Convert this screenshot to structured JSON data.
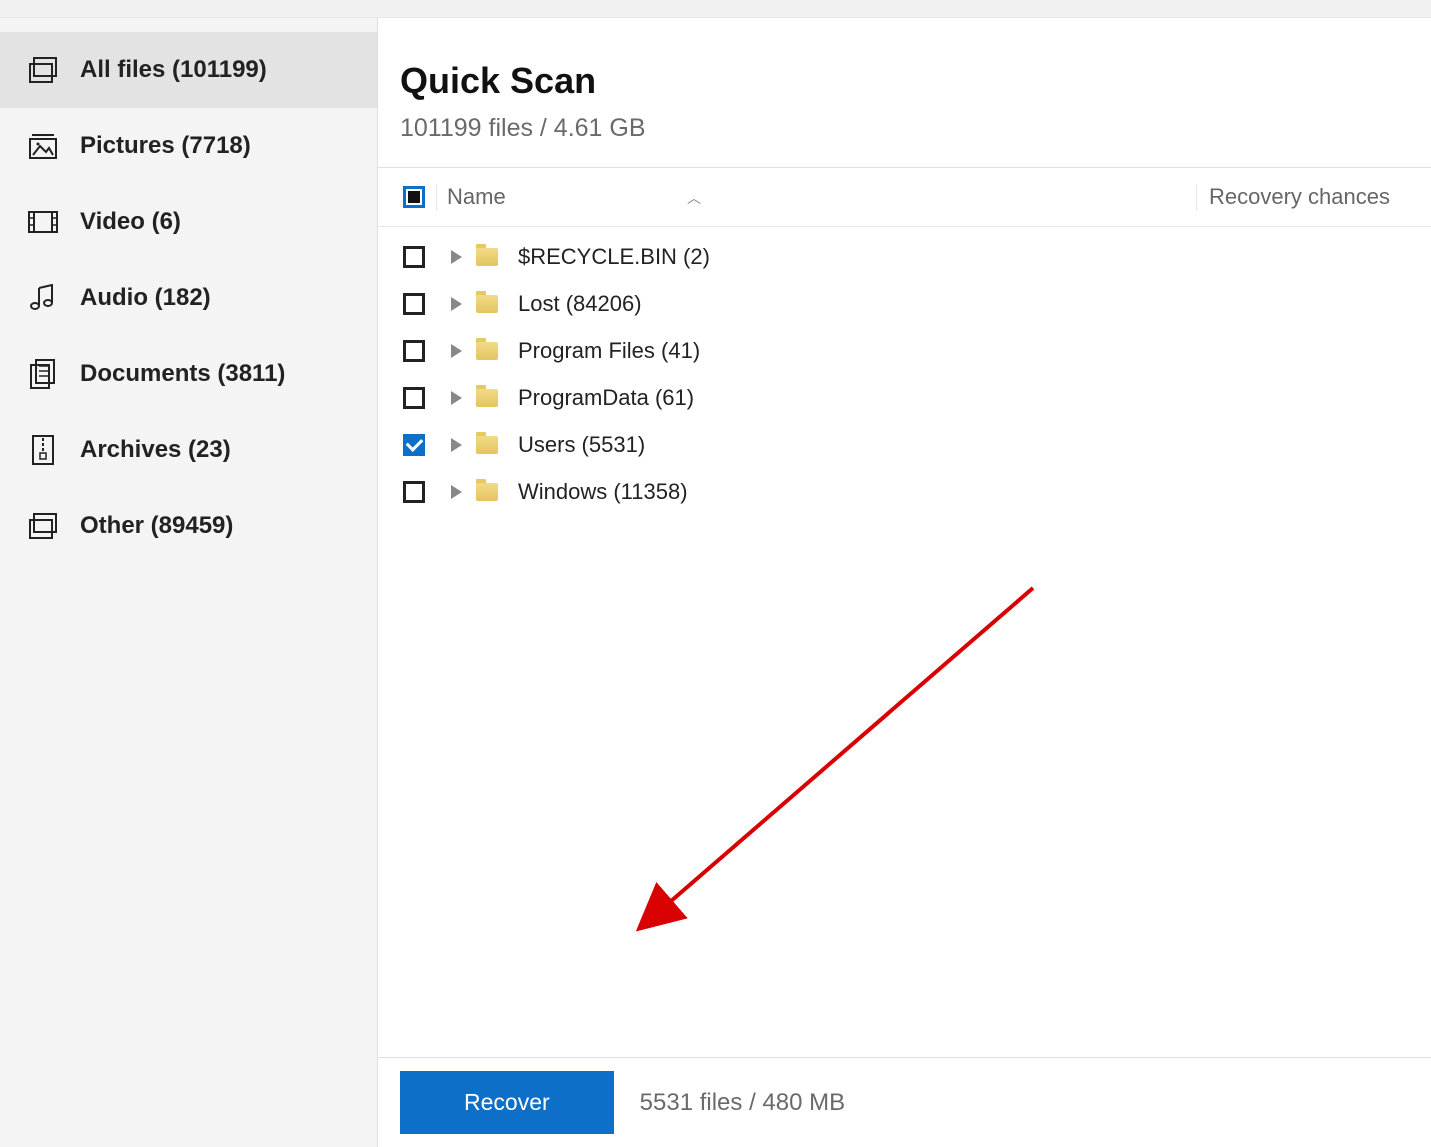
{
  "sidebar": {
    "items": [
      {
        "label": "All files (101199)"
      },
      {
        "label": "Pictures (7718)"
      },
      {
        "label": "Video (6)"
      },
      {
        "label": "Audio (182)"
      },
      {
        "label": "Documents (3811)"
      },
      {
        "label": "Archives (23)"
      },
      {
        "label": "Other (89459)"
      }
    ]
  },
  "main": {
    "title": "Quick Scan",
    "subtitle": "101199 files / 4.61 GB"
  },
  "table": {
    "columns": {
      "name": "Name",
      "recovery": "Recovery chances"
    },
    "rows": [
      {
        "name": "$RECYCLE.BIN (2)",
        "checked": false
      },
      {
        "name": "Lost (84206)",
        "checked": false
      },
      {
        "name": "Program Files (41)",
        "checked": false
      },
      {
        "name": "ProgramData (61)",
        "checked": false
      },
      {
        "name": "Users (5531)",
        "checked": true
      },
      {
        "name": "Windows (11358)",
        "checked": false
      }
    ]
  },
  "footer": {
    "recover_label": "Recover",
    "status": "5531 files / 480 MB"
  }
}
